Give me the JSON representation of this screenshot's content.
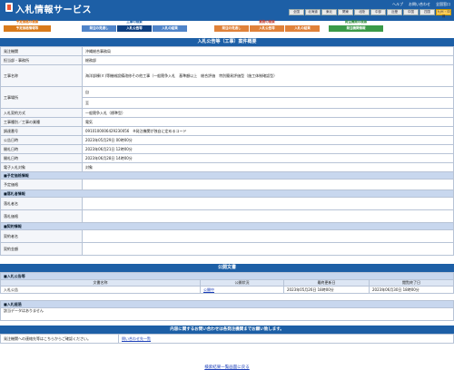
{
  "header": {
    "site_title": "入札情報サービス",
    "top_links": [
      "ヘルプ",
      "お問い合わせ",
      "全国窓口"
    ],
    "regions": [
      "全国",
      "北海道",
      "東北",
      "関東",
      "北陸",
      "中部",
      "近畿",
      "中国",
      "四国",
      "九州・沖縄"
    ],
    "active_region": 9
  },
  "nav": {
    "group1": {
      "caption": "予定価格の検索",
      "tabs": [
        "予定価格情報等"
      ]
    },
    "group2": {
      "caption": "工事の検索",
      "tabs": [
        "発注の見通し",
        "入札公告等",
        "入札の結果"
      ]
    },
    "group3": {
      "caption": "業務の検索",
      "tabs": [
        "発注の見通し",
        "入札公告等",
        "入札の結果"
      ]
    },
    "group4": {
      "caption": "発注機関の検索",
      "tabs": [
        "発注機関情報"
      ]
    }
  },
  "detail": {
    "heading": "入札公告等（工事）案件概要",
    "rows": [
      {
        "label": "発注機関",
        "value": "沖縄総合事務局"
      },
      {
        "label": "担当部・事務所",
        "value": "総務部"
      },
      {
        "label": "工事名称",
        "value": "海洋部棟(Ｅ)等機械設備改修その他工事（一般競争入札　基準額以上　総合評価　特別簡易評価型（施工体制確認型）"
      }
    ],
    "place_label": "工事場所",
    "place_values": [
      "自",
      "至"
    ],
    "rows2": [
      {
        "label": "入札契約方式",
        "value": "一般競争入札（標準型）"
      },
      {
        "label": "工事種別／工事の業種",
        "value": "電気"
      },
      {
        "label": "調達番号",
        "value": "0910100006429230056"
      },
      {
        "label": "公告日時",
        "value": "2023年05月29日 00時00分"
      },
      {
        "label": "開札日時",
        "value": "2023年06月21日 12時00分"
      },
      {
        "label": "開札日時",
        "value": "2023年06月28日 14時00分"
      },
      {
        "label": "電子入札対象",
        "value": "対象"
      }
    ],
    "code_note": "※発注機関が独自に定めるコード",
    "section_price": "■予定価格情報",
    "price_label": "予定価格",
    "section_result": "■落札者情報",
    "result_rows": [
      "落札者名",
      "落札価格"
    ],
    "section_contract": "■契約情報",
    "contract_rows": [
      "契約者名",
      "契約金額"
    ]
  },
  "documents": {
    "heading": "公開文書",
    "sub": "■入札公告等",
    "columns": [
      "文書名称",
      "公開状況",
      "最終更新日",
      "閲覧終了日"
    ],
    "row": {
      "name": "入札公告",
      "status": "公開中",
      "updated": "2023年05月26日 18時00分",
      "end": "2023年06月30日 18時00分"
    }
  },
  "flow": {
    "sub": "■入札経過",
    "note": "該当データはありません"
  },
  "contact": {
    "heading": "内容に関するお問い合わせは各発注機関までお願い致します。",
    "text": "発注機関への連絡先等はこちらからご確認ください。",
    "link": "問い合わせ先一覧"
  },
  "footer_link": "検索結果一覧画面に戻る"
}
